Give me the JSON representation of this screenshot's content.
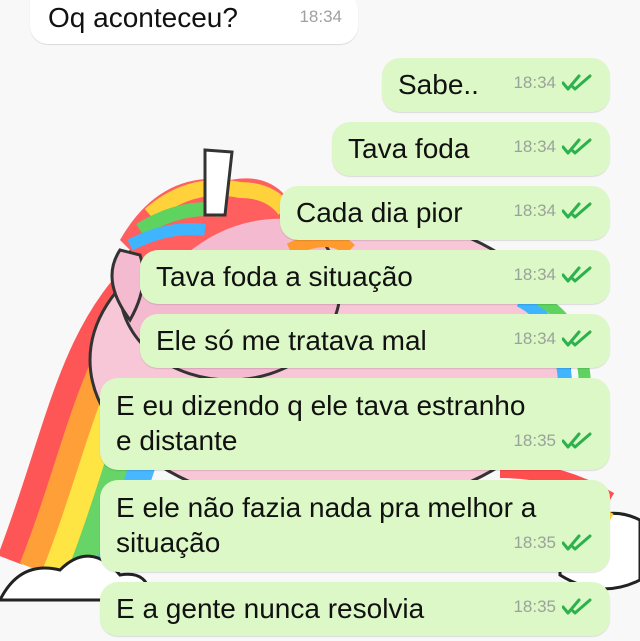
{
  "colors": {
    "incoming_bubble": "#ffffff",
    "outgoing_bubble": "#dcf8c6",
    "read_ticks": "#2bb24c",
    "timestamp": "#9aa39a"
  },
  "icons": {
    "read_receipt": "double-check-icon"
  },
  "messages": [
    {
      "direction": "incoming",
      "text": "Oq aconteceu?",
      "time": "18:34"
    },
    {
      "direction": "outgoing",
      "text": "Sabe..",
      "time": "18:34",
      "status": "read"
    },
    {
      "direction": "outgoing",
      "text": "Tava foda",
      "time": "18:34",
      "status": "read"
    },
    {
      "direction": "outgoing",
      "text": "Cada dia pior",
      "time": "18:34",
      "status": "read"
    },
    {
      "direction": "outgoing",
      "text": "Tava foda a situação",
      "time": "18:34",
      "status": "read"
    },
    {
      "direction": "outgoing",
      "text": "Ele só me tratava mal",
      "time": "18:34",
      "status": "read"
    },
    {
      "direction": "outgoing",
      "lines": [
        "E eu dizendo q ele tava estranho",
        "e distante"
      ],
      "time": "18:35",
      "status": "read"
    },
    {
      "direction": "outgoing",
      "lines": [
        "E ele não fazia nada pra melhor a",
        "situação"
      ],
      "time": "18:35",
      "status": "read"
    },
    {
      "direction": "outgoing",
      "text": "E a gente nunca resolvia",
      "time": "18:35",
      "status": "read"
    }
  ]
}
